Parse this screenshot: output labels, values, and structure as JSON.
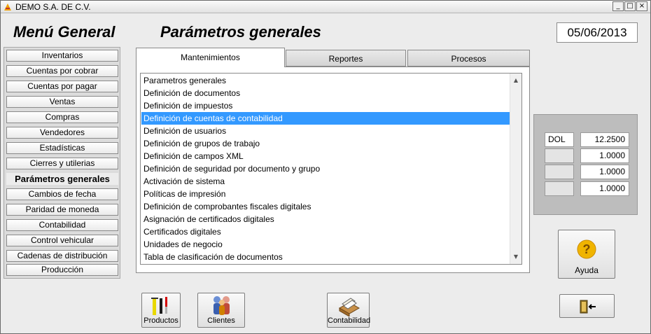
{
  "window": {
    "title": "DEMO  S.A. DE C.V.",
    "controls": [
      "_",
      "□",
      "×"
    ]
  },
  "header": {
    "menu_title": "Menú General",
    "page_title": "Parámetros generales",
    "date": "05/06/2013"
  },
  "sidebar": {
    "items": [
      {
        "label": "Inventarios"
      },
      {
        "label": "Cuentas por cobrar"
      },
      {
        "label": "Cuentas por pagar"
      },
      {
        "label": "Ventas"
      },
      {
        "label": "Compras"
      },
      {
        "label": "Vendedores"
      },
      {
        "label": "Estadísticas"
      },
      {
        "label": "Cierres y utilerias"
      },
      {
        "label": "Parámetros generales"
      },
      {
        "label": "Cambios de fecha"
      },
      {
        "label": "Paridad de moneda"
      },
      {
        "label": "Contabilidad"
      },
      {
        "label": "Control vehicular"
      },
      {
        "label": "Cadenas de distribución"
      },
      {
        "label": "Producción"
      }
    ],
    "active": "Parámetros generales"
  },
  "tabs": [
    {
      "label": "Mantenimientos"
    },
    {
      "label": "Reportes"
    },
    {
      "label": "Procesos"
    }
  ],
  "list": {
    "items": [
      {
        "label": "Parametros generales"
      },
      {
        "label": "Definición de documentos"
      },
      {
        "label": "Definición de impuestos"
      },
      {
        "label": "Definición de cuentas de contabilidad"
      },
      {
        "label": "Definición de usuarios"
      },
      {
        "label": "Definición de grupos de trabajo"
      },
      {
        "label": "Definición de campos XML"
      },
      {
        "label": "Definición de seguridad por documento y grupo"
      },
      {
        "label": "Activación  de sistema"
      },
      {
        "label": "Políticas de  impresión"
      },
      {
        "label": "Definición de comprobantes fiscales digitales"
      },
      {
        "label": "Asignación de certificados digitales"
      },
      {
        "label": "Certificados digitales"
      },
      {
        "label": "Unidades de negocio"
      },
      {
        "label": "Tabla de clasificación de documentos"
      }
    ],
    "selected": "Definición de cuentas de contabilidad"
  },
  "rates": [
    {
      "code": "DOL",
      "value": "12.2500"
    },
    {
      "code": "",
      "value": "1.0000"
    },
    {
      "code": "",
      "value": "1.0000"
    },
    {
      "code": "",
      "value": "1.0000"
    }
  ],
  "buttons": {
    "productos": "Productos",
    "clientes": "Clientes",
    "contabilidad": "Contabilidad",
    "ayuda": "Ayuda"
  },
  "colors": {
    "selection": "#3399ff",
    "help_icon": "#f0b400"
  }
}
